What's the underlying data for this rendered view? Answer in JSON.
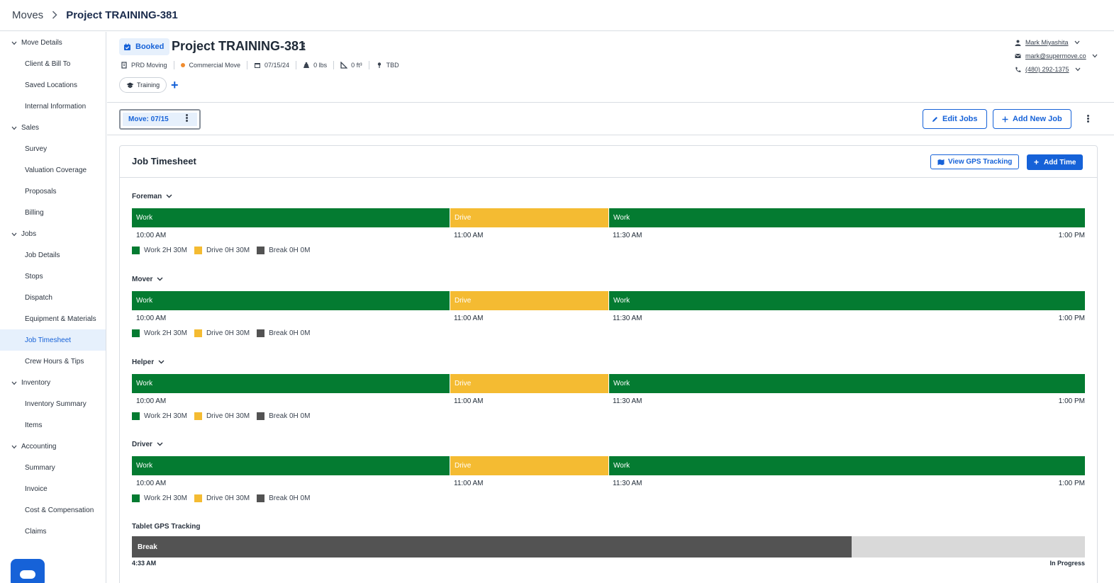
{
  "breadcrumb": {
    "parent": "Moves",
    "current": "Project TRAINING-381"
  },
  "sidebar": {
    "sections": [
      {
        "label": "Move Details",
        "items": [
          "Client & Bill To",
          "Saved Locations",
          "Internal Information"
        ]
      },
      {
        "label": "Sales",
        "items": [
          "Survey",
          "Valuation Coverage",
          "Proposals",
          "Billing"
        ]
      },
      {
        "label": "Jobs",
        "items": [
          "Job Details",
          "Stops",
          "Dispatch",
          "Equipment & Materials",
          "Job Timesheet",
          "Crew Hours & Tips"
        ]
      },
      {
        "label": "Inventory",
        "items": [
          "Inventory Summary",
          "Items"
        ]
      },
      {
        "label": "Accounting",
        "items": [
          "Summary",
          "Invoice",
          "Cost & Compensation",
          "Claims"
        ]
      }
    ],
    "active_item": "Job Timesheet"
  },
  "header": {
    "status": "Booked",
    "title": "Project TRAINING-381",
    "meta": {
      "organization": "PRD Moving",
      "move_type": "Commercial Move",
      "date": "07/15/24",
      "weight": "0 lbs",
      "volume": "0 ft³",
      "location": "TBD"
    },
    "tag": "Training",
    "contact": {
      "name": "Mark Miyashita",
      "email": "mark@supermove.co",
      "phone": "(480) 292-1375"
    }
  },
  "jobbar": {
    "move_tab": "Move: 07/15",
    "edit_jobs": "Edit Jobs",
    "add_new_job": "Add New Job"
  },
  "timesheet": {
    "title": "Job Timesheet",
    "view_gps": "View GPS Tracking",
    "add_time": "Add Time",
    "roles": [
      {
        "name": "Foreman"
      },
      {
        "name": "Mover"
      },
      {
        "name": "Helper"
      },
      {
        "name": "Driver"
      }
    ],
    "segments": [
      {
        "type": "work",
        "label": "Work",
        "start_fraction": 0.0,
        "end_fraction": 0.333
      },
      {
        "type": "drive",
        "label": "Drive",
        "start_fraction": 0.333,
        "end_fraction": 0.5
      },
      {
        "type": "work",
        "label": "Work",
        "start_fraction": 0.5,
        "end_fraction": 1.0
      }
    ],
    "ticks": [
      "10:00 AM",
      "11:00 AM",
      "11:30 AM",
      "1:00 PM"
    ],
    "legend": [
      {
        "label": "Work 2H 30M",
        "color": "#047b31"
      },
      {
        "label": "Drive 0H 30M",
        "color": "#f4bb32"
      },
      {
        "label": "Break 0H 0M",
        "color": "#535353"
      }
    ],
    "gps": {
      "title": "Tablet GPS Tracking",
      "break_label": "Break",
      "break_fraction": 0.755,
      "start": "4:33 AM",
      "end": "In Progress"
    }
  },
  "colors": {
    "accent": "#1662d8",
    "work": "#047b31",
    "drive": "#f4bb32",
    "break": "#535353"
  }
}
